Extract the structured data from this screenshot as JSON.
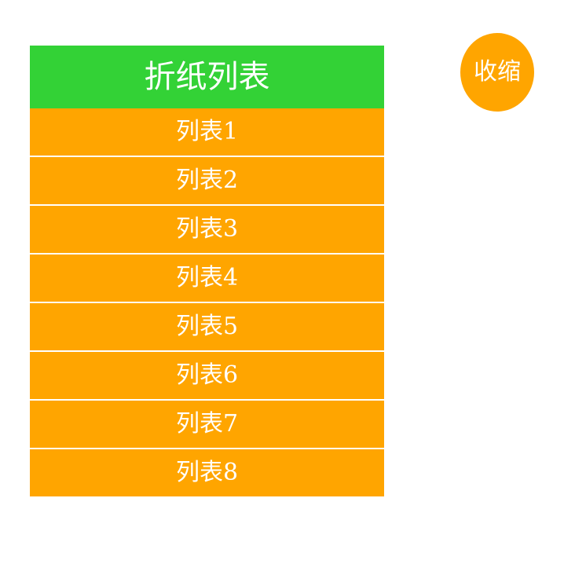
{
  "colors": {
    "header_bg": "#33d236",
    "item_bg": "#ffa500",
    "text": "#ffffff",
    "page_bg": "#ffffff"
  },
  "fold_list": {
    "title": "折纸列表",
    "items": [
      {
        "label": "列表1"
      },
      {
        "label": "列表2"
      },
      {
        "label": "列表3"
      },
      {
        "label": "列表4"
      },
      {
        "label": "列表5"
      },
      {
        "label": "列表6"
      },
      {
        "label": "列表7"
      },
      {
        "label": "列表8"
      }
    ]
  },
  "collapse_button": {
    "label": "收缩"
  }
}
